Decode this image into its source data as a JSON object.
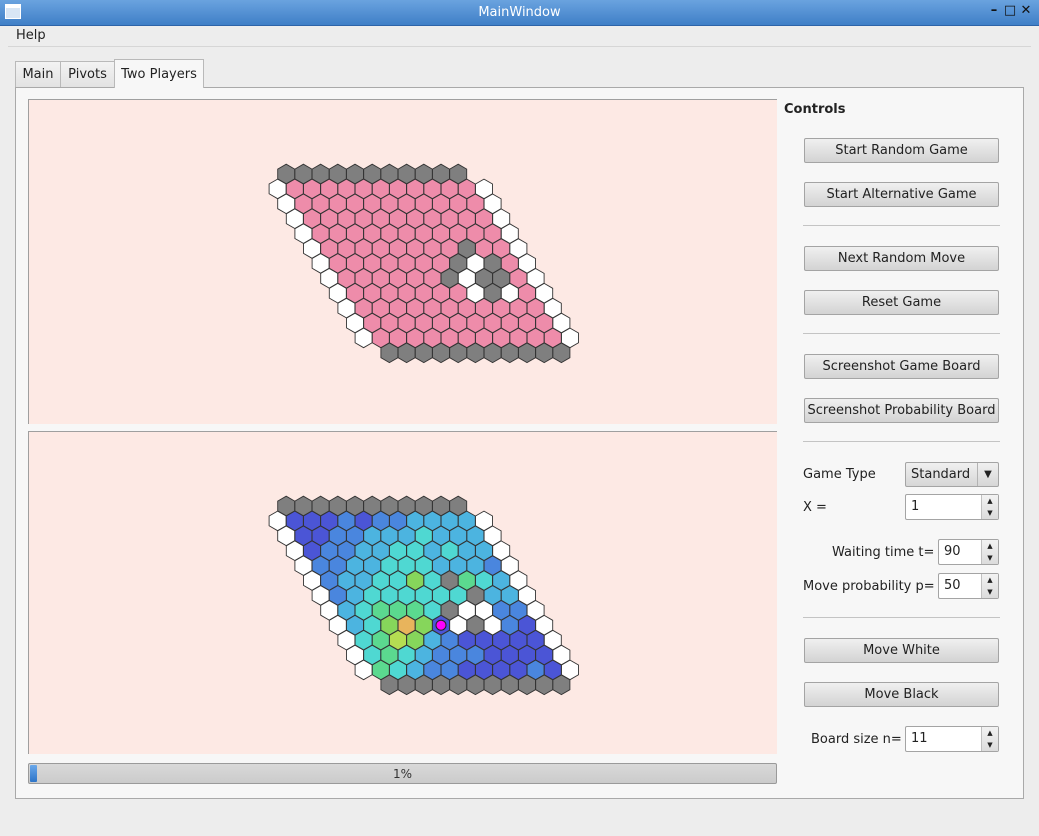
{
  "window": {
    "title": "MainWindow"
  },
  "menu": {
    "help": "Help"
  },
  "tabs": [
    {
      "label": "Main"
    },
    {
      "label": "Pivots"
    },
    {
      "label": "Two Players"
    }
  ],
  "controls": {
    "title": "Controls",
    "start_random": "Start Random Game",
    "start_alternative": "Start Alternative Game",
    "next_random_move": "Next Random Move",
    "reset_game": "Reset Game",
    "screenshot_game": "Screenshot Game Board",
    "screenshot_prob": "Screenshot Probability Board",
    "game_type_label": "Game Type",
    "game_type_value": "Standard",
    "x_label": "X =",
    "x_value": "1",
    "waiting_label": "Waiting time t=",
    "waiting_value": "90",
    "moveprob_label": "Move probability p=",
    "moveprob_value": "50",
    "move_white": "Move White",
    "move_black": "Move Black",
    "board_size_label": "Board size n=",
    "board_size_value": "11"
  },
  "progress": {
    "text": "1%",
    "value": 0.01
  },
  "colors": {
    "pink": "#ee8caa",
    "gray": "#7f7f7f",
    "white": "#ffffff",
    "marker": "#ff00ff",
    "background": "#fde9e4"
  },
  "boards": {
    "game": {
      "size": 11,
      "black_cells": [
        [
          4,
          8
        ],
        [
          5,
          7
        ],
        [
          5,
          9
        ],
        [
          6,
          6
        ],
        [
          6,
          8
        ],
        [
          6,
          9
        ],
        [
          7,
          8
        ]
      ],
      "white_cells": [
        [
          5,
          8
        ],
        [
          6,
          7
        ],
        [
          7,
          7
        ],
        [
          7,
          9
        ]
      ]
    },
    "probability": {
      "size": 11,
      "palette": [
        "#4b55d6",
        "#4a86de",
        "#4cb4e0",
        "#4fd8d2",
        "#5bd98f",
        "#86d65b",
        "#b5dd52",
        "#e8b45c"
      ],
      "levels": [
        [
          0,
          0,
          0,
          1,
          0,
          1,
          1,
          2,
          2,
          2,
          2
        ],
        [
          0,
          0,
          1,
          1,
          2,
          2,
          2,
          3,
          2,
          2,
          2
        ],
        [
          0,
          1,
          1,
          2,
          2,
          3,
          3,
          2,
          3,
          2,
          2
        ],
        [
          1,
          1,
          2,
          2,
          3,
          3,
          3,
          2,
          2,
          2,
          1
        ],
        [
          1,
          2,
          2,
          3,
          3,
          5,
          3,
          0,
          4,
          3,
          2
        ],
        [
          1,
          2,
          3,
          3,
          3,
          3,
          3,
          3,
          3,
          2,
          2
        ],
        [
          2,
          3,
          4,
          4,
          4,
          3,
          3,
          2,
          2,
          1,
          1
        ],
        [
          2,
          3,
          5,
          7,
          5,
          0,
          0,
          0,
          1,
          1,
          0
        ],
        [
          3,
          4,
          6,
          5,
          2,
          1,
          0,
          0,
          0,
          0,
          0
        ],
        [
          3,
          4,
          3,
          2,
          1,
          1,
          1,
          0,
          0,
          0,
          0
        ],
        [
          4,
          3,
          2,
          1,
          1,
          0,
          0,
          0,
          0,
          1,
          0
        ]
      ],
      "black_cells": [
        [
          4,
          7
        ],
        [
          5,
          8
        ],
        [
          6,
          6
        ],
        [
          7,
          7
        ]
      ],
      "white_cells": [
        [
          6,
          7
        ],
        [
          6,
          8
        ],
        [
          7,
          6
        ],
        [
          7,
          8
        ]
      ],
      "marker": [
        7,
        5
      ]
    }
  }
}
